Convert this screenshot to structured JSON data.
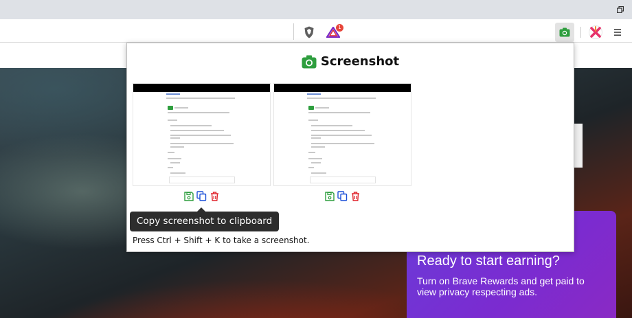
{
  "popup": {
    "title": "Screenshot",
    "tooltip": "Copy screenshot to clipboard",
    "hint": "Press Ctrl + Shift + K to take a screenshot.",
    "thumbnails": [
      {
        "actions": [
          "save-icon",
          "copy-icon",
          "delete-icon"
        ]
      },
      {
        "actions": [
          "save-icon",
          "copy-icon",
          "delete-icon"
        ]
      }
    ]
  },
  "toolbar": {
    "notification_count": "1"
  },
  "rewards": {
    "title": "Ready to start earning?",
    "text": "Turn on Brave Rewards and get paid to view privacy respecting ads."
  },
  "colors": {
    "accent_green": "#2e9e3e",
    "copy_blue": "#1a4fd8",
    "delete_red": "#e0242c",
    "rewards_purple": "#6a3bd8"
  }
}
